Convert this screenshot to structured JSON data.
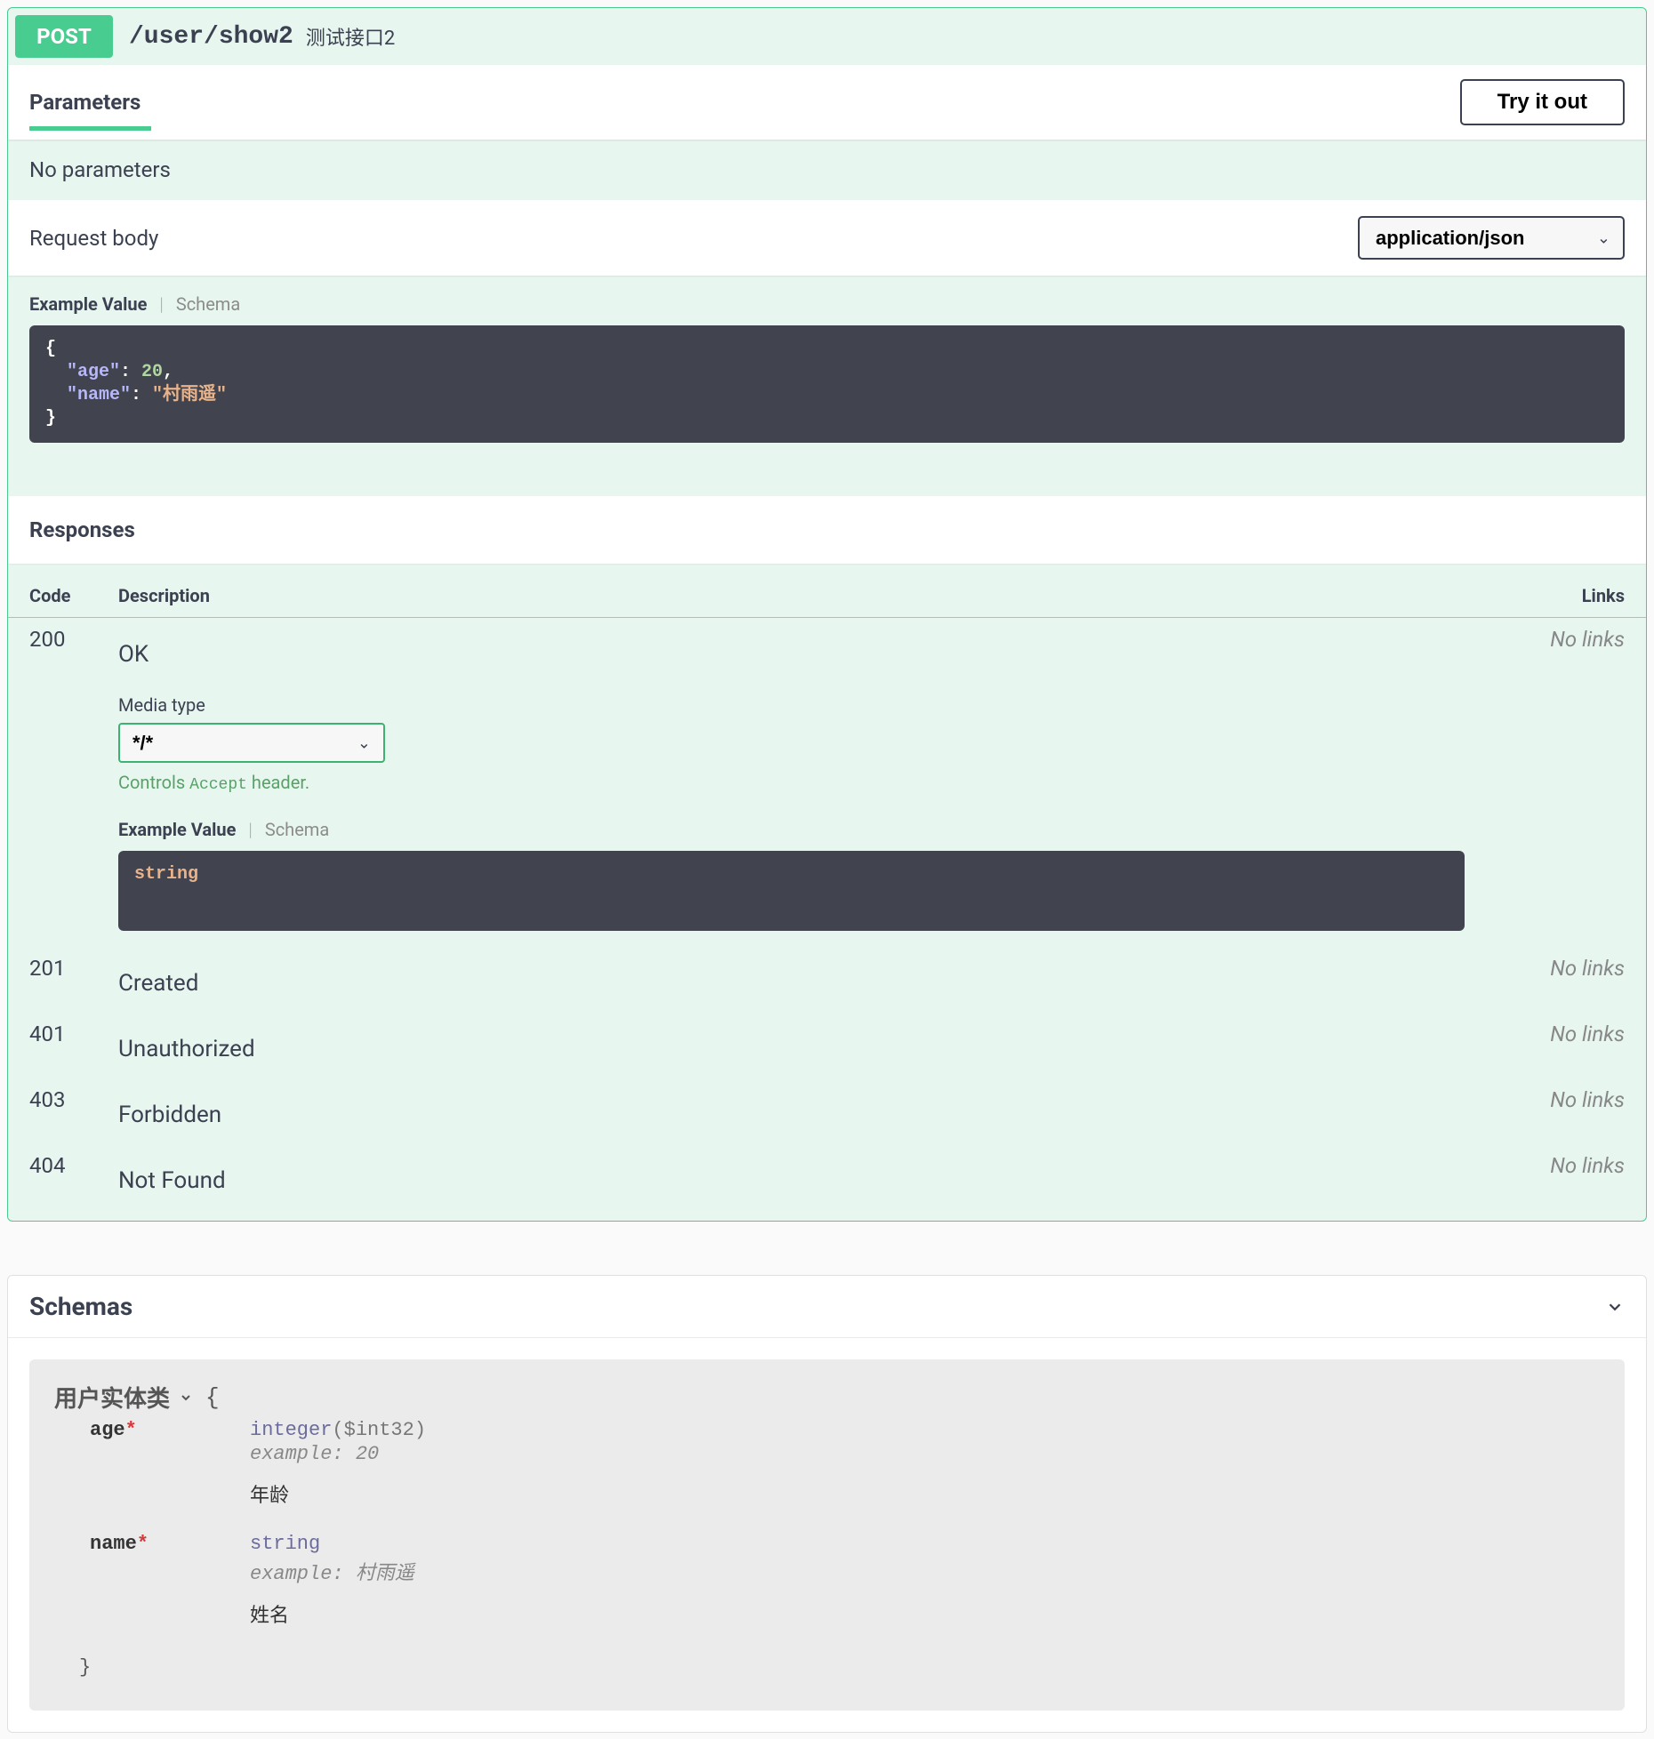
{
  "operation": {
    "method": "POST",
    "path": "/user/show2",
    "summary": "测试接口2"
  },
  "parameters": {
    "title": "Parameters",
    "try_it_out": "Try it out",
    "empty_text": "No parameters"
  },
  "request_body": {
    "title": "Request body",
    "content_type": "application/json",
    "tabs": {
      "example": "Example Value",
      "schema": "Schema"
    },
    "example_json": {
      "age": 20,
      "name": "村雨遥"
    }
  },
  "responses": {
    "title": "Responses",
    "headers": {
      "code": "Code",
      "description": "Description",
      "links": "Links"
    },
    "no_links": "No links",
    "media_type_label": "Media type",
    "media_type_value": "*/*",
    "controls_note_prefix": "Controls ",
    "controls_note_code": "Accept",
    "controls_note_suffix": " header.",
    "tabs": {
      "example": "Example Value",
      "schema": "Schema"
    },
    "example_body": "string",
    "items": [
      {
        "code": "200",
        "description": "OK",
        "has_media": true
      },
      {
        "code": "201",
        "description": "Created",
        "has_media": false
      },
      {
        "code": "401",
        "description": "Unauthorized",
        "has_media": false
      },
      {
        "code": "403",
        "description": "Forbidden",
        "has_media": false
      },
      {
        "code": "404",
        "description": "Not Found",
        "has_media": false
      }
    ]
  },
  "schemas": {
    "title": "Schemas",
    "model": {
      "name": "用户实体类",
      "props": [
        {
          "name": "age",
          "required": true,
          "type": "integer",
          "format": "$int32",
          "example_label": "example: 20",
          "desc": "年龄"
        },
        {
          "name": "name",
          "required": true,
          "type": "string",
          "format": "",
          "example_label": "example: 村雨遥",
          "desc": "姓名"
        }
      ]
    }
  }
}
